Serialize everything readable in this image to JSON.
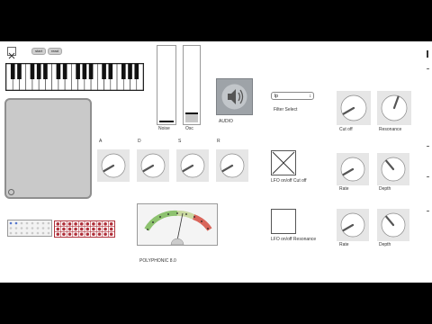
{
  "toolbar": {
    "close_icon": "close-icon",
    "start_label": "start",
    "read_label": "read"
  },
  "sliders": [
    {
      "label": "Noise",
      "level": 0.0
    },
    {
      "label": "Osc",
      "level": 0.12
    }
  ],
  "audio": {
    "label": "AUDIO",
    "icon": "speaker-icon"
  },
  "filter": {
    "label": "Filter Select",
    "value": "lp"
  },
  "envelope": {
    "labels": [
      "A",
      "D",
      "S",
      "R"
    ]
  },
  "filter_knobs": [
    {
      "label": "Cut off"
    },
    {
      "label": "Resonance"
    }
  ],
  "lfo1": {
    "toggle_label": "LFO on/off Cut off",
    "rate_label": "Rate",
    "depth_label": "Depth",
    "checked": true
  },
  "lfo2": {
    "toggle_label": "LFO on/off Resonance",
    "rate_label": "Rate",
    "depth_label": "Depth",
    "checked": false
  },
  "meter": {
    "label": "POLYPHONIC 8.0"
  },
  "colors": {
    "dial_bg": "#e6e6e6",
    "grid_red": "#b0303a",
    "meter_green": "#8dc26f",
    "meter_red": "#d9655a"
  }
}
